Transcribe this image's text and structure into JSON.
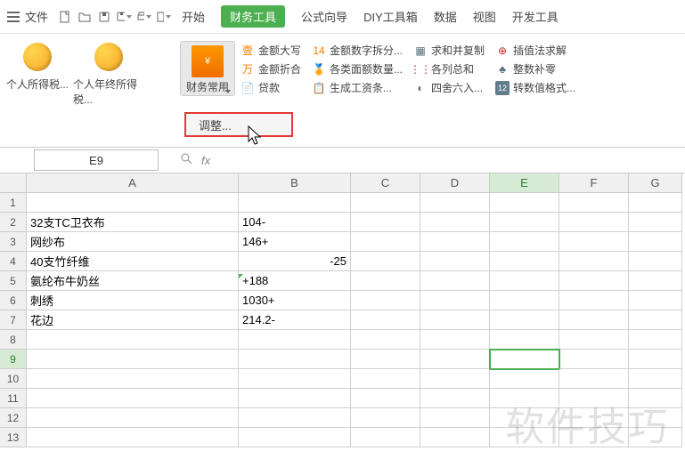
{
  "menubar": {
    "file": "文件"
  },
  "tabs": {
    "t1": "开始",
    "t2": "财务工具",
    "t3": "公式向导",
    "t4": "DIY工具箱",
    "t5": "数据",
    "t6": "视图",
    "t7": "开发工具"
  },
  "ribbon": {
    "personal_tax": "个人所得税...",
    "annual_tax": "个人年终所得税...",
    "finance_common": "财务常用",
    "amount_upper": "金额大写",
    "amount_fold": "金额折合",
    "loan": "贷款",
    "digit_split": "金额数字拆分...",
    "denomination": "各类面额数量...",
    "payslip": "生成工资条...",
    "sum_merge": "求和并复制",
    "col_sum": "各列总和",
    "round_in": "四舍六入...",
    "insert_solve": "插值法求解",
    "pad_zero": "整数补零",
    "num_format": "转数值格式..."
  },
  "dropdown": {
    "item": "调整..."
  },
  "namebox": "E9",
  "colheaders": [
    "A",
    "B",
    "C",
    "D",
    "E",
    "F",
    "G"
  ],
  "rows": {
    "r2": {
      "a": "32支TC卫衣布",
      "b": "104-"
    },
    "r3": {
      "a": "网纱布",
      "b": "146+"
    },
    "r4": {
      "a": "40支竹纤维",
      "b": "-25"
    },
    "r5": {
      "a": "氨纶布牛奶丝",
      "b": "+188"
    },
    "r6": {
      "a": "刺绣",
      "b": "1030+"
    },
    "r7": {
      "a": "花边",
      "b": "214.2-"
    }
  },
  "watermark": "软件技巧"
}
